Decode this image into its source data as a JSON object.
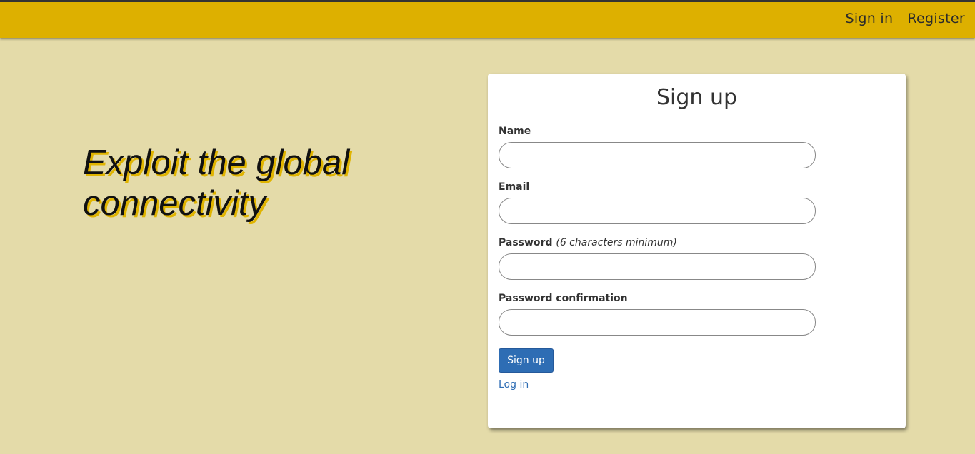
{
  "nav": {
    "sign_in": "Sign in",
    "register": "Register"
  },
  "hero": {
    "headline": "Exploit the global connectivity"
  },
  "form": {
    "title": "Sign up",
    "fields": [
      {
        "label": "Name",
        "hint": "",
        "value": ""
      },
      {
        "label": "Email",
        "hint": "",
        "value": ""
      },
      {
        "label": "Password",
        "hint": "(6 characters minimum)",
        "value": ""
      },
      {
        "label": "Password confirmation",
        "hint": "",
        "value": ""
      }
    ],
    "submit_label": "Sign up",
    "login_link": "Log in"
  },
  "colors": {
    "background": "#e4dba9",
    "topbar": "#ddb000",
    "button": "#2e6db4",
    "link": "#2e6db4"
  }
}
